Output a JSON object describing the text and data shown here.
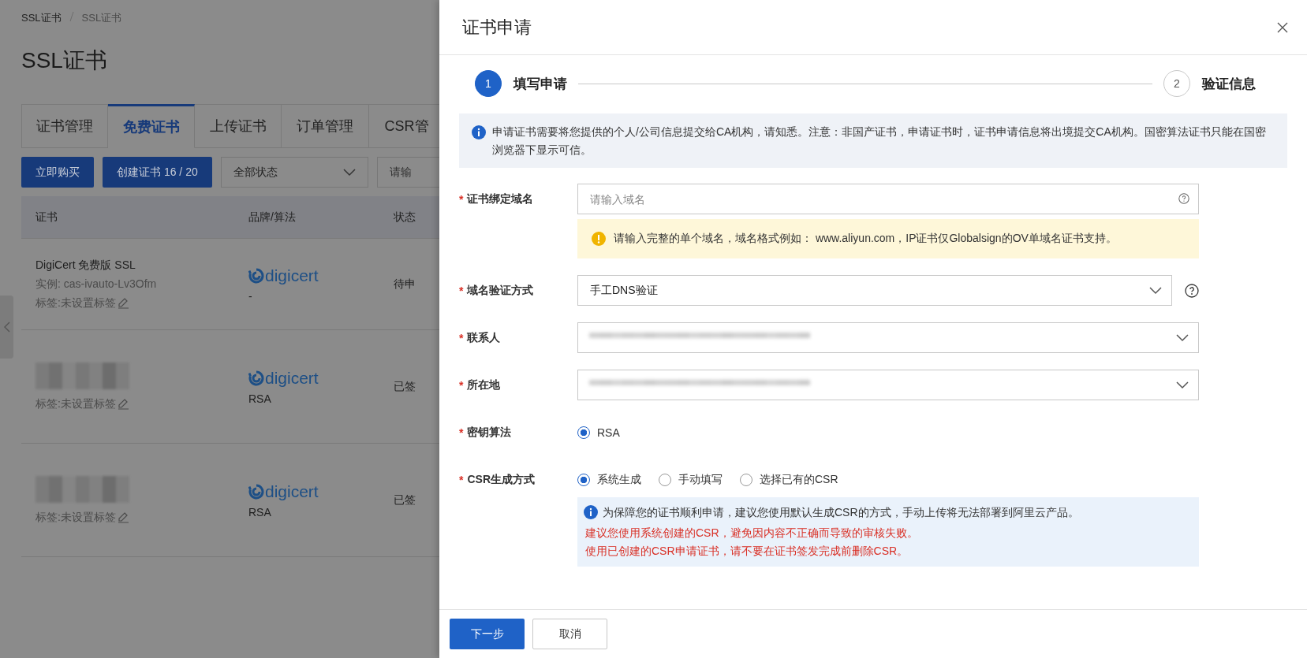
{
  "breadcrumb": [
    "SSL证书",
    "SSL证书"
  ],
  "page_title": "SSL证书",
  "tabs": [
    {
      "label": "证书管理",
      "selected": false
    },
    {
      "label": "免费证书",
      "selected": true
    },
    {
      "label": "上传证书",
      "selected": false
    },
    {
      "label": "订单管理",
      "selected": false
    },
    {
      "label": "CSR管",
      "selected": false
    }
  ],
  "toolbar": {
    "buy_button": "立即购买",
    "create_button": "创建证书 16 / 20",
    "status_select": "全部状态",
    "search_placeholder": "请输"
  },
  "table": {
    "columns": [
      "证书",
      "品牌/算法",
      "状态"
    ],
    "rows": [
      {
        "title": "DigiCert 免费版 SSL",
        "instance": "实例: cas-ivauto-Lv3Ofm",
        "tag": "标签:未设置标签",
        "brand": "digicert",
        "algorithm": "-",
        "status": "待申",
        "redacted": false
      },
      {
        "tag": "标签:未设置标签",
        "brand": "digicert",
        "algorithm": "RSA",
        "status": "已签",
        "redacted": true
      },
      {
        "tag": "标签:未设置标签",
        "brand": "digicert",
        "algorithm": "RSA",
        "status": "已签",
        "redacted": true
      }
    ]
  },
  "drawer": {
    "title": "证书申请",
    "steps": [
      {
        "number": "1",
        "label": "填写申请",
        "selected": true
      },
      {
        "number": "2",
        "label": "验证信息",
        "selected": false
      }
    ],
    "notice": "申请证书需要将您提供的个人/公司信息提交给CA机构，请知悉。注意：非国产证书，申请证书时，证书申请信息将出境提交CA机构。国密算法证书只能在国密浏览器下显示可信。",
    "fields": [
      {
        "kind": "text",
        "required_mark": "*",
        "label": "证书绑定域名",
        "placeholder": "请输入域名",
        "hint": "请输入完整的单个域名，域名格式例如： www.aliyun.com，IP证书仅Globalsign的OV单域名证书支持。"
      },
      {
        "kind": "select",
        "required_mark": "*",
        "label": "域名验证方式",
        "value": "手工DNS验证",
        "help": true
      },
      {
        "kind": "select",
        "required_mark": "*",
        "label": "联系人",
        "redacted": true
      },
      {
        "kind": "select",
        "required_mark": "*",
        "label": "所在地",
        "redacted": true
      },
      {
        "kind": "radio",
        "required_mark": "*",
        "label": "密钥算法",
        "options": [
          {
            "label": "RSA",
            "selected": true
          }
        ]
      },
      {
        "kind": "radio",
        "required_mark": "*",
        "label": "CSR生成方式",
        "options": [
          {
            "label": "系统生成",
            "selected": true
          },
          {
            "label": "手动填写",
            "selected": false
          },
          {
            "label": "选择已有的CSR",
            "selected": false
          }
        ],
        "notice": {
          "text": "为保障您的证书顺利申请，建议您使用默认生成CSR的方式，手动上传将无法部署到阿里云产品。",
          "warnings": [
            "建议您使用系统创建的CSR，避免因内容不正确而导致的审核失败。",
            "使用已创建的CSR申请证书，请不要在证书签发完成前删除CSR。"
          ]
        }
      }
    ],
    "buttons": [
      {
        "label": "下一步",
        "kind": "primary"
      },
      {
        "label": "取消",
        "kind": "default"
      }
    ]
  }
}
